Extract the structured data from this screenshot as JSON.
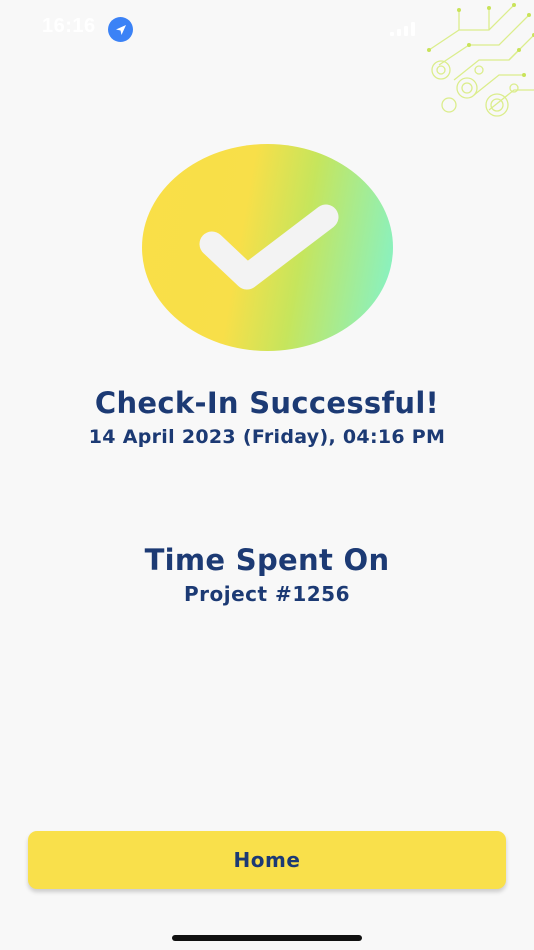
{
  "status_bar": {
    "time": "16:16",
    "location_icon": "location-arrow-icon",
    "signal_icon": "cellular-signal-icon"
  },
  "decoration": {
    "icon": "circuit-pattern-icon"
  },
  "success": {
    "icon": "checkmark-icon",
    "title": "Check-In Successful!",
    "datetime": "14 April 2023 (Friday), 04:16 PM"
  },
  "time_spent": {
    "heading": "Time Spent On",
    "project": "Project #1256"
  },
  "actions": {
    "home_label": "Home"
  },
  "colors": {
    "text_primary": "#1c3a74",
    "button_bg": "#f9e04b",
    "gradient_start": "#f9df47",
    "gradient_end": "#7ef5cd"
  }
}
